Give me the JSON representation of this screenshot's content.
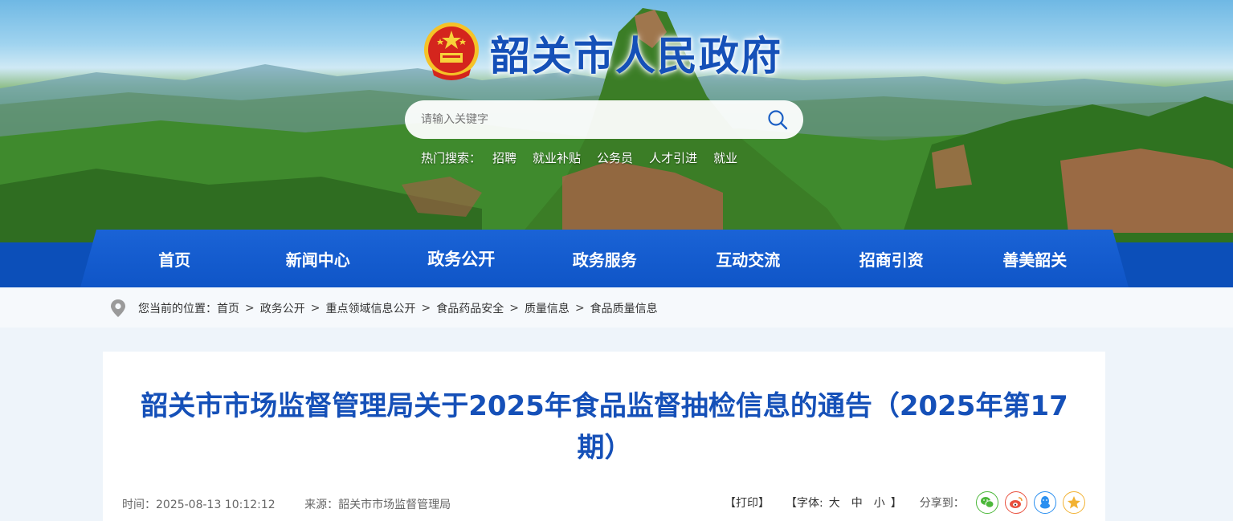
{
  "header": {
    "site_title": "韶关市人民政府"
  },
  "search": {
    "placeholder": "请输入关键字",
    "hot_label": "热门搜索：",
    "hot_terms": [
      "招聘",
      "就业补贴",
      "公务员",
      "人才引进",
      "就业"
    ]
  },
  "nav": {
    "items": [
      "首页",
      "新闻中心",
      "政务公开",
      "政务服务",
      "互动交流",
      "招商引资",
      "善美韶关"
    ],
    "active": "政务公开"
  },
  "breadcrumb": {
    "prefix": "您当前的位置：",
    "items": [
      "首页",
      "政务公开",
      "重点领域信息公开",
      "食品药品安全",
      "质量信息",
      "食品质量信息"
    ],
    "separator": ">"
  },
  "article": {
    "title": "韶关市市场监督管理局关于2025年食品监督抽检信息的通告（2025年第17期）",
    "time": "时间：2025-08-13 10:12:12",
    "source": "来源：韶关市市场监督管理局"
  },
  "tools": {
    "print": "【打印】",
    "font_open": "【字体:",
    "font_large": "大",
    "font_medium": "中",
    "font_small": "小",
    "font_close": "】",
    "share_label": "分享到："
  },
  "colors": {
    "brand_blue": "#1550b8",
    "nav_blue": "#0f55c7",
    "wechat": "#4cb83a",
    "weibo": "#e9503e",
    "qq": "#2a8ff0",
    "qzone": "#f2b233"
  },
  "icons": {
    "emblem": "national-emblem-icon",
    "search": "search-icon",
    "location": "location-pin-icon",
    "share": [
      "wechat-icon",
      "weibo-icon",
      "qq-icon",
      "qzone-icon"
    ]
  }
}
